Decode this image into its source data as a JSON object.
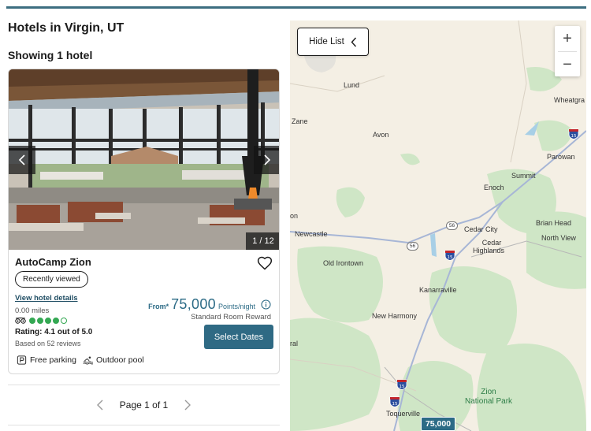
{
  "page": {
    "title": "Hotels in Virgin, UT",
    "result_count": "Showing 1 hotel"
  },
  "hotel": {
    "name": "AutoCamp Zion",
    "photo_counter": "1 / 12",
    "badge": "Recently viewed",
    "details_link": "View hotel details",
    "distance": "0.00 miles",
    "rating_dots_filled": 4,
    "rating_dots_total": 5,
    "rating": "Rating: 4.1 out of 5.0",
    "reviews": "Based on 52 reviews",
    "price_prefix": "From*",
    "price": "75,000",
    "price_unit": "Points/night",
    "reward_type": "Standard Room Reward",
    "cta": "Select Dates",
    "amenities": [
      {
        "icon": "parking-icon",
        "label": "Free parking"
      },
      {
        "icon": "pool-icon",
        "label": "Outdoor pool"
      }
    ]
  },
  "pager": {
    "label": "Page 1 of 1"
  },
  "map": {
    "hide_list": "Hide List",
    "zoom_in": "+",
    "zoom_out": "−",
    "marker_price": "75,000",
    "places": {
      "lund": "Lund",
      "wheatgrass": "Wheatgra",
      "zane": "Zane",
      "avon": "Avon",
      "parowan": "Parowan",
      "summit": "Summit",
      "enoch": "Enoch",
      "on": "on",
      "newcastle": "Newcastle",
      "cedar_city": "Cedar City",
      "cedar_highlands_1": "Cedar",
      "cedar_highlands_2": "Highlands",
      "brian_head": "Brian Head",
      "north_view": "North View",
      "old_irontown": "Old Irontown",
      "kanarraville": "Kanarraville",
      "new_harmony": "New Harmony",
      "ral": "ral",
      "toquerville": "Toquerville",
      "zion_1": "Zion",
      "zion_2": "National Park"
    },
    "highway_15": "15",
    "route_56": "56"
  },
  "colors": {
    "accent": "#2c6b86",
    "top_rule": "#3c6e80",
    "rating_green": "#34a853",
    "map_land": "#f4efe4",
    "map_forest": "#cfe6c6"
  }
}
